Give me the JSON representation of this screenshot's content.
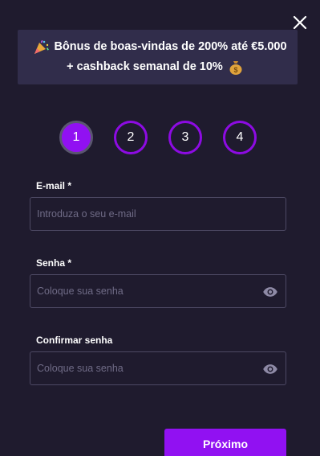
{
  "banner": {
    "line1": "Bônus de boas-vindas de 200% até €5.000",
    "line2": "+ cashback semanal de 10%",
    "icon_left": "party-popper-icon",
    "icon_right": "money-bag-icon"
  },
  "steps": [
    {
      "label": "1",
      "active": true
    },
    {
      "label": "2",
      "active": false
    },
    {
      "label": "3",
      "active": false
    },
    {
      "label": "4",
      "active": false
    }
  ],
  "form": {
    "email": {
      "label": "E-mail *",
      "placeholder": "Introduza o seu e-mail",
      "value": ""
    },
    "password": {
      "label": "Senha *",
      "placeholder": "Coloque sua senha",
      "value": ""
    },
    "confirm_password": {
      "label": "Confirmar senha",
      "placeholder": "Coloque sua senha",
      "value": ""
    }
  },
  "buttons": {
    "next_label": "Próximo"
  },
  "colors": {
    "background": "#1f1b2e",
    "banner_bg": "#312d4b",
    "accent": "#9111f2",
    "step_ring": "#8d0be3",
    "input_border": "#4d4964",
    "placeholder": "#6f6b86"
  }
}
